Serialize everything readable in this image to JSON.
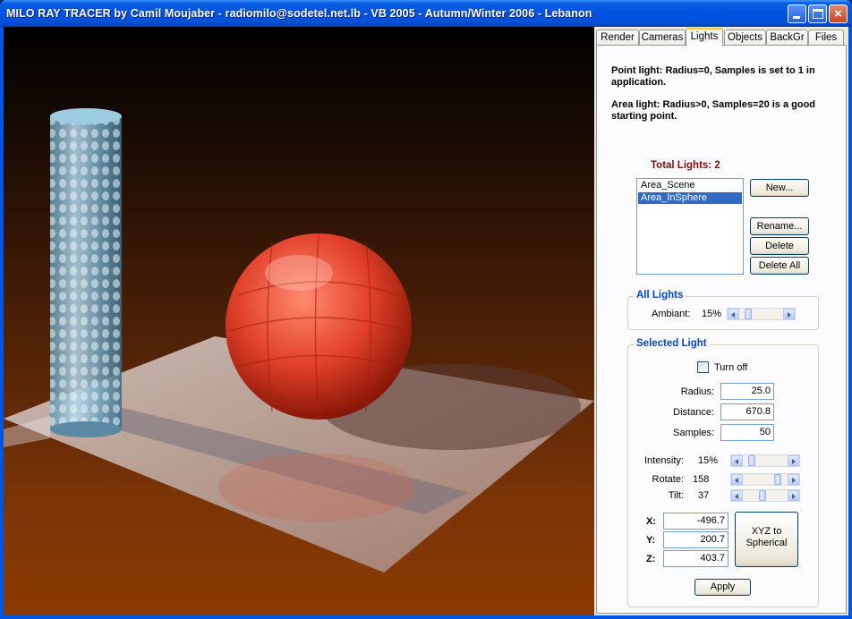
{
  "window": {
    "title": "MILO RAY TRACER by Camil Moujaber - radiomilo@sodetel.net.lb - VB 2005 - Autumn/Winter 2006 - Lebanon",
    "close_glyph": "×"
  },
  "tabs": [
    {
      "label": "Render",
      "active": false
    },
    {
      "label": "Cameras",
      "active": false
    },
    {
      "label": "Lights",
      "active": true
    },
    {
      "label": "Objects",
      "active": false
    },
    {
      "label": "BackGr",
      "active": false
    },
    {
      "label": "Files",
      "active": false
    }
  ],
  "lights": {
    "note_point": "Point light: Radius=0, Samples is set to 1 in application.",
    "note_area": "Area light: Radius>0, Samples=20 is a good starting point.",
    "total_label": "Total Lights:",
    "total_count": "2",
    "list": [
      "Area_Scene",
      "Area_InSphere"
    ],
    "selected_index": 1,
    "buttons": {
      "new": "New...",
      "rename": "Rename...",
      "delete": "Delete",
      "delete_all": "Delete All"
    },
    "all_lights": {
      "title": "All Lights",
      "ambient_label": "Ambiant:",
      "ambient_value": "15%",
      "ambient_fraction": 0.15
    },
    "selected_light": {
      "title": "Selected Light",
      "turn_off_label": "Turn off",
      "turn_off_checked": false,
      "radius_label": "Radius:",
      "radius_value": "25.0",
      "distance_label": "Distance:",
      "distance_value": "670.8",
      "samples_label": "Samples:",
      "samples_value": "50",
      "intensity_label": "Intensity:",
      "intensity_value": "15%",
      "intensity_fraction": 0.15,
      "rotate_label": "Rotate:",
      "rotate_value": "158",
      "rotate_fraction": 0.88,
      "tilt_label": "Tilt:",
      "tilt_value": "37",
      "tilt_fraction": 0.45,
      "x_label": "X:",
      "x_value": "-496.7",
      "y_label": "Y:",
      "y_value": "200.7",
      "z_label": "Z:",
      "z_value": "403.7",
      "xyz_button": "XYZ to Spherical",
      "apply_button": "Apply"
    }
  },
  "colors": {
    "title_bar": "#0053e1",
    "group_title": "#0046d5",
    "total_text": "#7b1010",
    "selection": "#316ac5"
  }
}
